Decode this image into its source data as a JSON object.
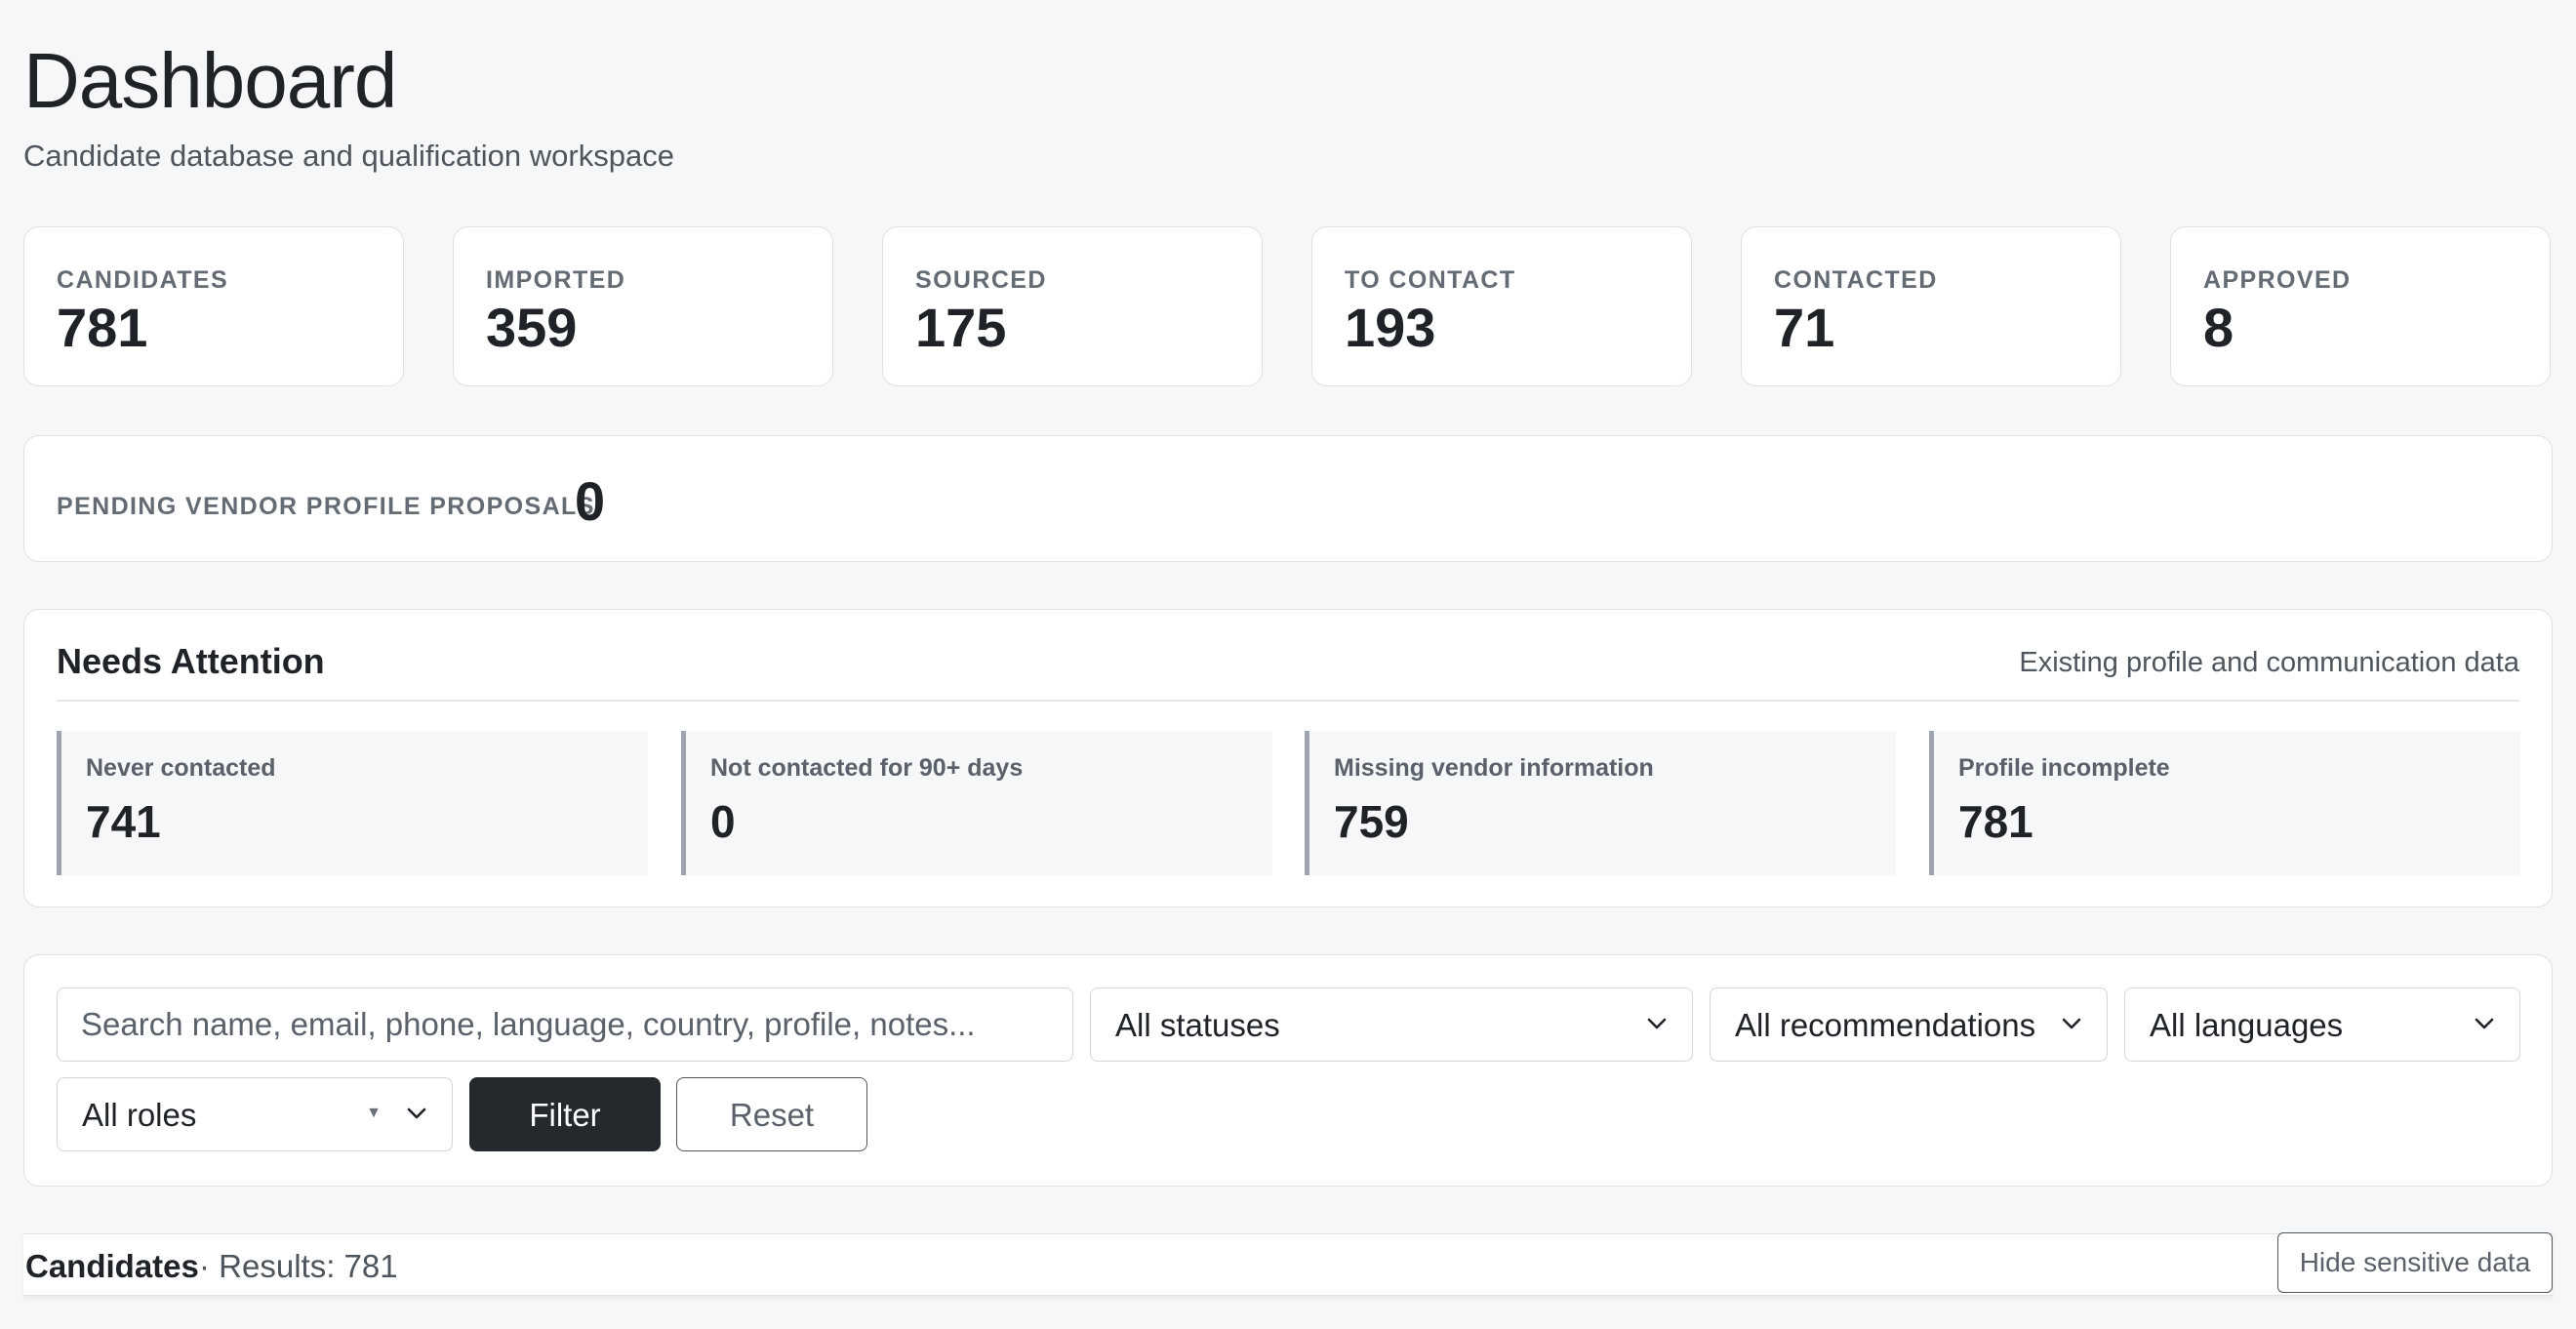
{
  "header": {
    "title": "Dashboard",
    "subtitle": "Candidate database and qualification workspace"
  },
  "stats": [
    {
      "label": "CANDIDATES",
      "value": "781"
    },
    {
      "label": "IMPORTED",
      "value": "359"
    },
    {
      "label": "SOURCED",
      "value": "175"
    },
    {
      "label": "TO CONTACT",
      "value": "193"
    },
    {
      "label": "CONTACTED",
      "value": "71"
    },
    {
      "label": "APPROVED",
      "value": "8"
    }
  ],
  "pending": {
    "label": "PENDING VENDOR PROFILE PROPOSALS",
    "value": "0"
  },
  "attention": {
    "title": "Needs Attention",
    "note": "Existing profile and communication data",
    "cards": [
      {
        "label": "Never contacted",
        "value": "741"
      },
      {
        "label": "Not contacted for 90+ days",
        "value": "0"
      },
      {
        "label": "Missing vendor information",
        "value": "759"
      },
      {
        "label": "Profile incomplete",
        "value": "781"
      }
    ]
  },
  "filters": {
    "search_placeholder": "Search name, email, phone, language, country, profile, notes...",
    "status_value": "All statuses",
    "recommendation_value": "All recommendations",
    "language_value": "All languages",
    "role_value": "All roles",
    "filter_label": "Filter",
    "reset_label": "Reset"
  },
  "candidates": {
    "title": "Candidates",
    "results": "· Results: 781",
    "hide_label": "Hide sensitive data"
  },
  "icons": {
    "chevron": "chevron-down-icon"
  },
  "colors": {
    "primary_button": "#25282c",
    "background": "#f6f7f9",
    "accent_bar": "#9ea4ad"
  }
}
